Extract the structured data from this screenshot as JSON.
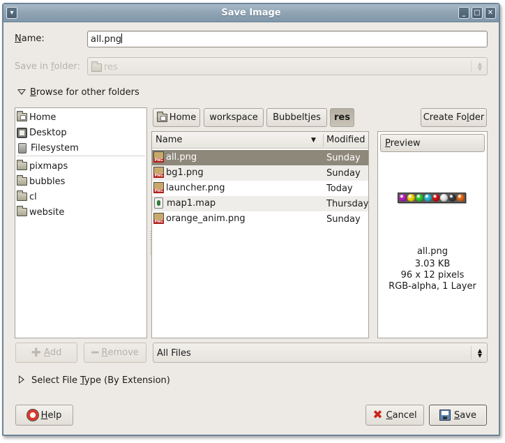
{
  "window": {
    "title": "Save Image",
    "controls": {
      "menu": "▾",
      "minimize": "_",
      "maximize": "□",
      "close": "✕"
    }
  },
  "form": {
    "name_label_u": "N",
    "name_label_rest": "ame:",
    "name_value": "all.png",
    "save_in_label_pre": "Save in ",
    "save_in_label_u": "f",
    "save_in_label_post": "older:",
    "save_in_value": "res",
    "browse_u": "B",
    "browse_rest": "rowse for other folders"
  },
  "places": {
    "system": [
      {
        "label": "Home",
        "icon": "home-folder-icon"
      },
      {
        "label": "Desktop",
        "icon": "desktop-icon"
      },
      {
        "label": "Filesystem",
        "icon": "filesystem-icon"
      }
    ],
    "bookmarks": [
      {
        "label": "pixmaps",
        "icon": "folder-icon"
      },
      {
        "label": "bubbles",
        "icon": "folder-icon"
      },
      {
        "label": "cl",
        "icon": "folder-icon"
      },
      {
        "label": "website",
        "icon": "folder-icon"
      }
    ],
    "add_label_u": "A",
    "add_label_rest": "dd",
    "remove_label_u": "R",
    "remove_label_rest": "emove"
  },
  "path_bar": {
    "segments": [
      "Home",
      "workspace",
      "Bubbeltjes",
      "res"
    ],
    "active": "res",
    "create_folder_pre": "Create Fo",
    "create_folder_u": "l",
    "create_folder_post": "der"
  },
  "file_list": {
    "columns": {
      "name": "Name",
      "modified": "Modified"
    },
    "rows": [
      {
        "name": "all.png",
        "modified": "Sunday",
        "type": "png",
        "selected": true
      },
      {
        "name": "bg1.png",
        "modified": "Sunday",
        "type": "png",
        "selected": false
      },
      {
        "name": "launcher.png",
        "modified": "Today",
        "type": "png",
        "selected": false
      },
      {
        "name": "map1.map",
        "modified": "Thursday",
        "type": "map",
        "selected": false
      },
      {
        "name": "orange_anim.png",
        "modified": "Sunday",
        "type": "png",
        "selected": false
      }
    ]
  },
  "filter": {
    "value": "All Files"
  },
  "preview": {
    "header_u": "P",
    "header_rest": "review",
    "thumbnail_colors": [
      "#b41fb4",
      "#f2d000",
      "#2dc82d",
      "#27b3cf",
      "#d40f0f",
      "#e8e8e8",
      "#3a3a3a",
      "#e8650f"
    ],
    "filename": "all.png",
    "size": "3.03 KB",
    "dimensions": "96 x 12 pixels",
    "mode": "RGB-alpha, 1 Layer"
  },
  "file_type": {
    "pre": "Select File ",
    "u": "T",
    "post": "ype (By Extension)"
  },
  "buttons": {
    "help_u": "H",
    "help_rest": "elp",
    "cancel_u": "C",
    "cancel_rest": "ancel",
    "save_u": "S",
    "save_rest": "ave"
  }
}
